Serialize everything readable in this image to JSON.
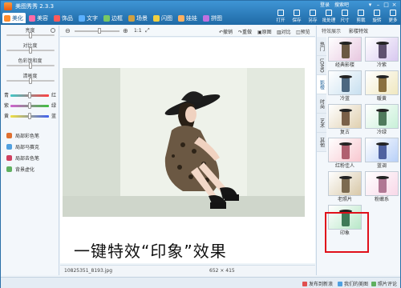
{
  "app": {
    "title": "美图秀秀 2.3.3",
    "user_links": [
      "登录",
      "搜索吧"
    ]
  },
  "main_tabs": [
    {
      "label": "美化",
      "active": true,
      "icon": "palette-icon",
      "color": "#ff8a2a"
    },
    {
      "label": "美容",
      "active": false,
      "icon": "face-icon",
      "color": "#ff6aa6"
    },
    {
      "label": "饰品",
      "active": false,
      "icon": "bow-icon",
      "color": "#ff5a5a"
    },
    {
      "label": "文字",
      "active": false,
      "icon": "text-icon",
      "color": "#5ab0ff"
    },
    {
      "label": "边框",
      "active": false,
      "icon": "frame-icon",
      "color": "#78c864"
    },
    {
      "label": "场景",
      "active": false,
      "icon": "scene-icon",
      "color": "#d0a040"
    },
    {
      "label": "闪图",
      "active": false,
      "icon": "flash-icon",
      "color": "#f0d040"
    },
    {
      "label": "娃娃",
      "active": false,
      "icon": "doll-icon",
      "color": "#ffb060"
    },
    {
      "label": "拼图",
      "active": false,
      "icon": "puzzle-icon",
      "color": "#c070e0"
    }
  ],
  "toolbar": [
    "打开",
    "保存",
    "另存",
    "批处理",
    "尺寸",
    "剪裁",
    "旋转",
    "更多"
  ],
  "left_panel": {
    "sliders": [
      {
        "label": "亮度",
        "value": 0.5
      },
      {
        "label": "对比度",
        "value": 0.5
      },
      {
        "label": "色彩饱和度",
        "value": 0.5
      },
      {
        "label": "清晰度",
        "value": 0.5
      }
    ],
    "color_sliders": [
      {
        "left": "青",
        "right": "红",
        "value": 0.5,
        "colors": [
          "#40c8c8",
          "#ff4040"
        ]
      },
      {
        "left": "紫",
        "right": "绿",
        "value": 0.5,
        "colors": [
          "#d060d0",
          "#40c040"
        ]
      },
      {
        "left": "黄",
        "right": "蓝",
        "value": 0.5,
        "colors": [
          "#f0e040",
          "#4060f0"
        ]
      }
    ],
    "paint_tools": [
      {
        "label": "局部彩色笔",
        "icon": "brush-icon",
        "color": "#e07030"
      },
      {
        "label": "局部马赛克",
        "icon": "mosaic-icon",
        "color": "#50a0e0"
      },
      {
        "label": "局部去色笔",
        "icon": "eraser-icon",
        "color": "#d04060"
      },
      {
        "label": "背景虚化",
        "icon": "blur-icon",
        "color": "#60b060"
      }
    ]
  },
  "canvas": {
    "zoom_label": "1:1",
    "zoom_value": 0.55,
    "actions": [
      "撤销",
      "重做",
      "原图",
      "对比",
      "预览"
    ],
    "caption": "一键特效“印象”效果",
    "filename": "10825351_8193.jpg",
    "dimensions": "652 × 415"
  },
  "right_panel": {
    "headers": [
      "特效展示",
      "影楼特效"
    ],
    "side_tabs": [
      "热门",
      "LOMO",
      "影楼",
      "时尚",
      "艺术",
      "其他"
    ],
    "active_side_tab": "影楼",
    "effects": [
      {
        "label": "经典影楼",
        "tint": "#e8c8e0"
      },
      {
        "label": "冷紫",
        "tint": "#d8c8f0"
      },
      {
        "label": "冷蓝",
        "tint": "#c8e0f0"
      },
      {
        "label": "暖黄",
        "tint": "#f0e8c0"
      },
      {
        "label": "复古",
        "tint": "#e0d0b0"
      },
      {
        "label": "冷绿",
        "tint": "#c8f0d8"
      },
      {
        "label": "红粉佳人",
        "tint": "#f8c8d0"
      },
      {
        "label": "蓝调",
        "tint": "#b8d0f8"
      },
      {
        "label": "老照片",
        "tint": "#d8c8a8"
      },
      {
        "label": "粉嫩系",
        "tint": "#f8d8e8"
      },
      {
        "label": "印象",
        "tint": "#b8e8c8"
      }
    ],
    "selected_effect": "印象"
  },
  "status_bar": [
    "发布到新浪",
    "我们的美图",
    "照片评论"
  ]
}
